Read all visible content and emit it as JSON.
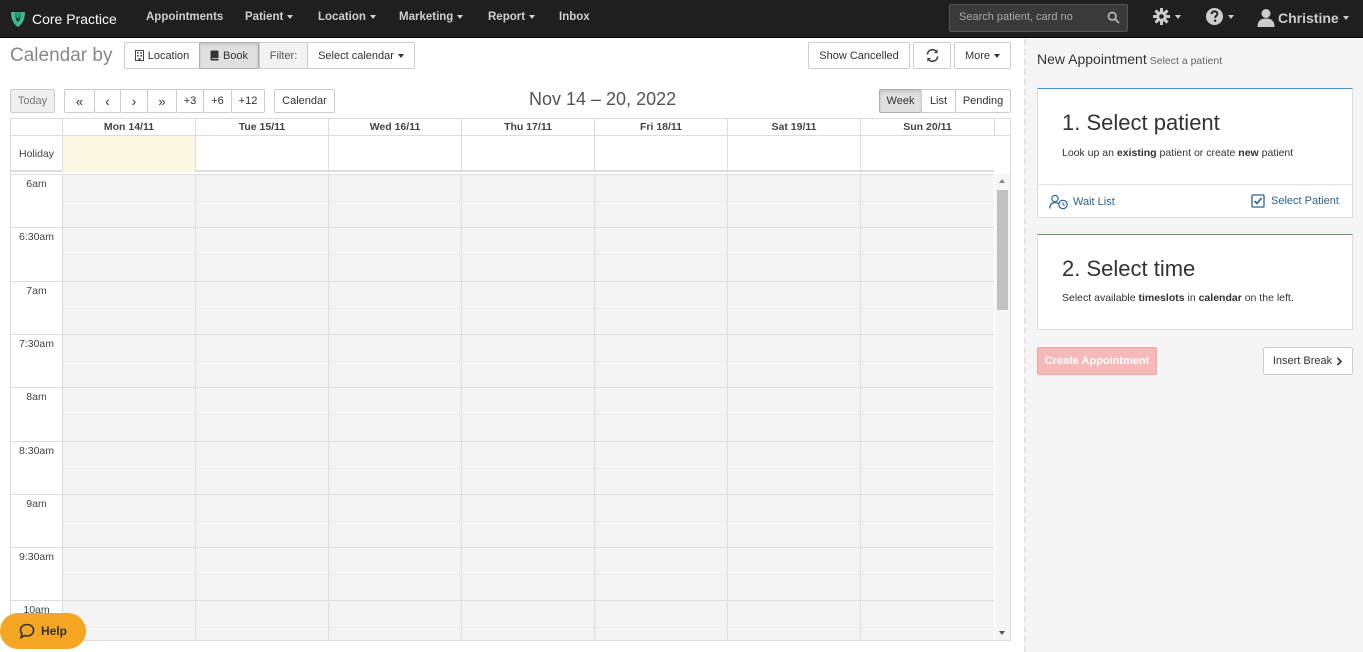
{
  "brand": {
    "name": "Core Practice"
  },
  "nav": {
    "appointments": "Appointments",
    "patient": "Patient",
    "location": "Location",
    "marketing": "Marketing",
    "report": "Report",
    "inbox": "Inbox",
    "search_placeholder": "Search patient, card no",
    "user": "Christine"
  },
  "toolbar": {
    "title": "Calendar by",
    "location": "Location",
    "book": "Book",
    "filter": "Filter:",
    "select_calendar": "Select calendar",
    "show_cancelled": "Show Cancelled",
    "more": "More",
    "today": "Today",
    "first": "«",
    "prev": "‹",
    "next": "›",
    "last": "»",
    "plus3": "+3",
    "plus6": "+6",
    "plus12": "+12",
    "calendar": "Calendar",
    "date_range": "Nov 14 – 20, 2022",
    "week": "Week",
    "list": "List",
    "pending": "Pending"
  },
  "calendar": {
    "days": [
      "Mon 14/11",
      "Tue 15/11",
      "Wed 16/11",
      "Thu 17/11",
      "Fri 18/11",
      "Sat 19/11",
      "Sun 20/11"
    ],
    "holiday_label": "Holiday",
    "times": [
      "6am",
      "6:30am",
      "7am",
      "7:30am",
      "8am",
      "8:30am",
      "9am",
      "9:30am",
      "10am"
    ]
  },
  "help": {
    "label": "Help"
  },
  "panel": {
    "title": "New Appointment",
    "subtitle": "Select a patient",
    "step1_title": "1. Select patient",
    "step1_text_a": "Look up an ",
    "step1_text_b": "existing",
    "step1_text_c": " patient or create ",
    "step1_text_d": "new",
    "step1_text_e": " patient",
    "wait_list": "Wait List",
    "select_patient": "Select Patient",
    "step2_title": "2. Select time",
    "step2_text_a": "Select available ",
    "step2_text_b": "timeslots",
    "step2_text_c": " in ",
    "step2_text_d": "calendar",
    "step2_text_e": " on the left.",
    "create": "Create Appointment",
    "insert_break": "Insert Break"
  },
  "colors": {
    "nav_bg": "#1f1f1f",
    "logo": "#3dbb8f",
    "help": "#f5a623",
    "create_disabled": "#f6b8b8",
    "today_highlight": "#fcf8e3",
    "card1_accent": "#4a90c8",
    "card2_accent": "#6a9a5a"
  }
}
